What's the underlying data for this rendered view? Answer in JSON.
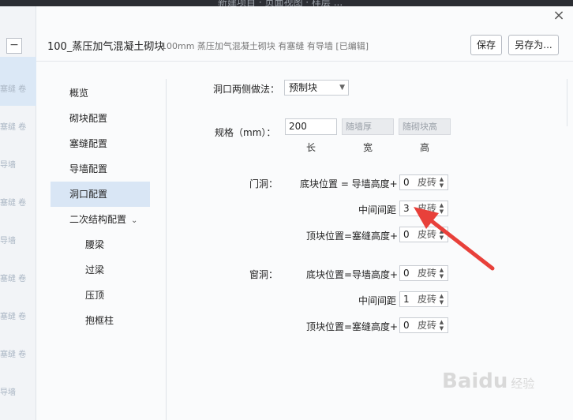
{
  "window": {
    "title_fragment": "新建项目 · 页面视图 · 样层 ..."
  },
  "left_strip": {
    "collapse_label": "−",
    "labels": [
      "塞缝 卷",
      "塞缝 卷",
      "导墙",
      "塞缝 卷",
      "导墙",
      "塞缝 卷",
      "塞缝 卷",
      "塞缝 卷",
      "导墙"
    ]
  },
  "dialog": {
    "close_label": "×",
    "title": "100_蒸压加气混凝土砌块",
    "subtitle": "100mm 蒸压加气混凝土砌块 有塞缝 有导墙 [已编辑]",
    "save_label": "保存",
    "saveas_label": "另存为..."
  },
  "nav": {
    "items": [
      {
        "label": "概览"
      },
      {
        "label": "砌块配置"
      },
      {
        "label": "塞缝配置"
      },
      {
        "label": "导墙配置"
      },
      {
        "label": "洞口配置",
        "active": true
      },
      {
        "label": "二次结构配置",
        "chevron": "⌄"
      },
      {
        "label": "腰梁"
      },
      {
        "label": "过梁"
      },
      {
        "label": "压顶"
      },
      {
        "label": "抱框柱"
      }
    ]
  },
  "form": {
    "side_method_label": "洞口两侧做法：",
    "side_method_value": "预制块",
    "spec_label": "规格（mm）：",
    "spec_length": "200",
    "spec_width_placeholder": "随墙厚",
    "spec_height_placeholder": "随砌块高",
    "spec_captions": [
      "长",
      "宽",
      "高"
    ],
    "door": {
      "label": "门洞：",
      "bottom_label": "底块位置 = 导墙高度+",
      "bottom_value": "0",
      "middle_label": "中间间距",
      "middle_value": "3",
      "top_label": "顶块位置=塞缝高度+",
      "top_value": "0"
    },
    "window": {
      "label": "窗洞：",
      "bottom_label": "底块位置=导墙高度+",
      "bottom_value": "0",
      "middle_label": "中间间距",
      "middle_value": "1",
      "top_label": "顶块位置=塞缝高度+",
      "top_value": "0"
    },
    "unit": "皮砖"
  },
  "annotation": {
    "arrow_color": "#e8403a"
  },
  "watermark": {
    "text": "Baidu",
    "suffix": "经验"
  }
}
